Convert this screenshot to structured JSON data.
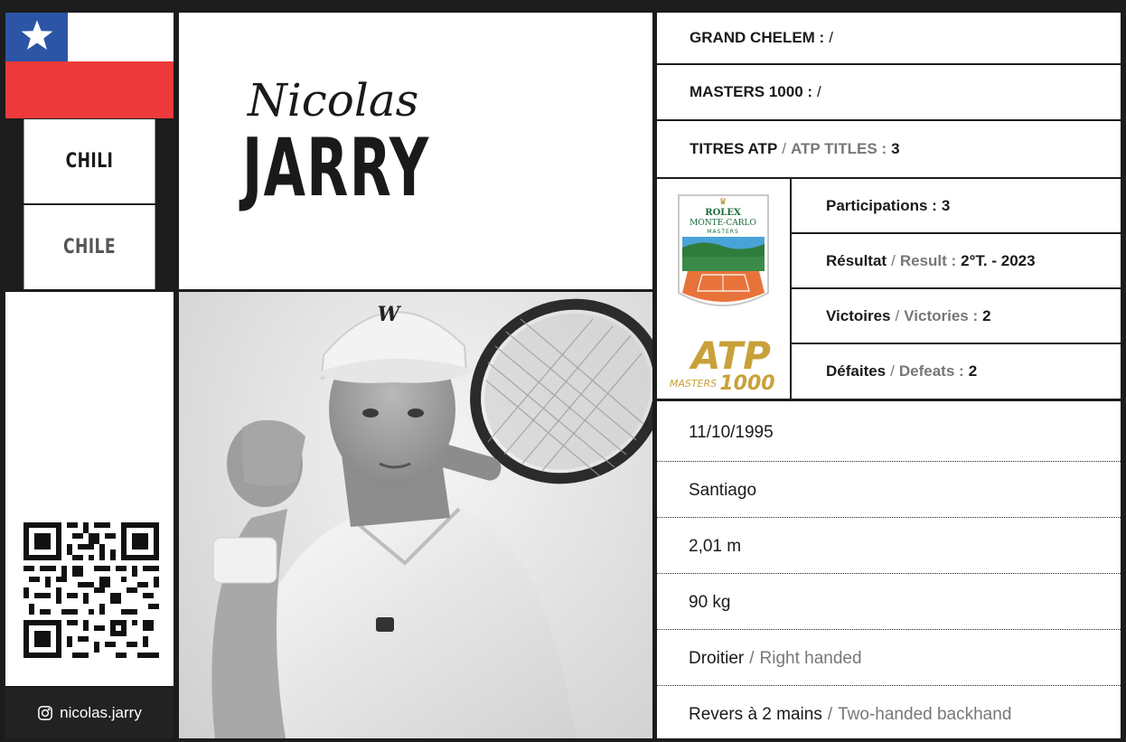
{
  "colors": {
    "flag_blue": "#2c55a6",
    "flag_red": "#ee3a3a",
    "dark": "#1c1c1c",
    "muted": "#777777"
  },
  "country": {
    "fr": "CHILI",
    "en": "CHILE"
  },
  "player": {
    "first_name": "Nicolas",
    "last_name": "JARRY"
  },
  "instagram": {
    "icon": "instagram-icon",
    "handle": "nicolas.jarry"
  },
  "career": {
    "grand_slam": {
      "label": "GRAND CHELEM :",
      "value": "/"
    },
    "masters": {
      "label": "MASTERS 1000 :",
      "value": "/"
    },
    "titles": {
      "label_fr": "TITRES ATP",
      "label_en": "ATP TITLES :",
      "value": "3"
    }
  },
  "monte_carlo": {
    "logo": {
      "brand": "ROLEX",
      "event": "MONTE-CARLO",
      "tier": "MASTERS"
    },
    "atp_logo": {
      "top": "ATP",
      "left": "MASTERS",
      "right": "1000"
    },
    "participations": {
      "label": "Participations :",
      "value": "3"
    },
    "result": {
      "label_fr": "Résultat",
      "label_en": "Result :",
      "value": "2°T. - 2023"
    },
    "victories": {
      "label_fr": "Victoires",
      "label_en": "Victories :",
      "value": "2"
    },
    "defeats": {
      "label_fr": "Défaites",
      "label_en": "Defeats :",
      "value": "2"
    }
  },
  "bio": {
    "birth_date": "11/10/1995",
    "birth_place": "Santiago",
    "height": "2,01 m",
    "weight": "90 kg",
    "plays": {
      "fr": "Droitier",
      "en": "Right handed"
    },
    "backhand": {
      "fr": "Revers à 2 mains",
      "en": "Two-handed backhand"
    }
  },
  "photo": {
    "cap_brand": "W"
  }
}
